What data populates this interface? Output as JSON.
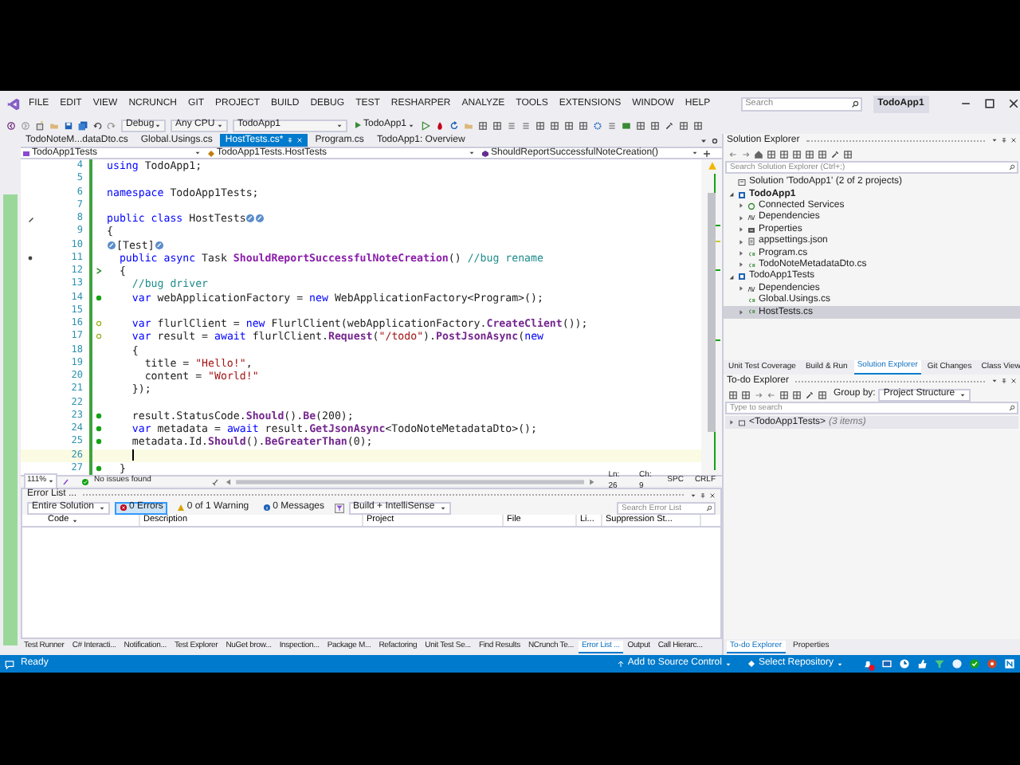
{
  "window": {
    "title": "TodoApp1"
  },
  "menu": [
    "FILE",
    "EDIT",
    "VIEW",
    "NCRUNCH",
    "GIT",
    "PROJECT",
    "BUILD",
    "DEBUG",
    "TEST",
    "RESHARPER",
    "ANALYZE",
    "TOOLS",
    "EXTENSIONS",
    "WINDOW",
    "HELP"
  ],
  "search": {
    "placeholder": "Search"
  },
  "toolbar": {
    "configuration": "Debug",
    "platform": "Any CPU",
    "startup_project": "TodoApp1",
    "start_button": "TodoApp1"
  },
  "document_tabs": [
    {
      "label": "TodoNoteM...dataDto.cs",
      "selected": false
    },
    {
      "label": "Global.Usings.cs",
      "selected": false
    },
    {
      "label": "HostTests.cs*",
      "selected": true
    },
    {
      "label": "Program.cs",
      "selected": false
    },
    {
      "label": "TodoApp1: Overview",
      "selected": false
    }
  ],
  "navigation_bar": [
    "TodoApp1Tests",
    "TodoApp1Tests.HostTests",
    "ShouldReportSuccessfulNoteCreation()"
  ],
  "editor": {
    "lines": [
      {
        "number": "4",
        "kind": "plain",
        "current": false,
        "segments": [
          {
            "kind": "keyword",
            "text": "using"
          },
          {
            "kind": "plain",
            "text": " TodoApp1;"
          }
        ]
      },
      {
        "number": "5",
        "kind": "plain",
        "current": false
      },
      {
        "number": "6",
        "kind": "plain",
        "current": false,
        "segments": [
          {
            "kind": "keyword",
            "text": "namespace"
          },
          {
            "kind": "plain",
            "text": " TodoApp1Tests;"
          }
        ]
      },
      {
        "number": "7",
        "kind": "plain",
        "current": false
      },
      {
        "number": "8",
        "kind": "plain",
        "current": false,
        "gutter": [
          {
            "kind": "edit"
          }
        ],
        "segments": [
          {
            "kind": "keyword",
            "text": "public class"
          },
          {
            "kind": "plain",
            "text": " HostTests"
          },
          {
            "kind": "hint"
          },
          {
            "kind": "hint"
          }
        ]
      },
      {
        "number": "9",
        "kind": "plain",
        "current": false,
        "segments": [
          {
            "kind": "plain",
            "text": "{"
          }
        ]
      },
      {
        "number": "10",
        "kind": "plain",
        "current": false,
        "segments": [
          {
            "kind": "hint"
          },
          {
            "kind": "plain",
            "text": "[Test]"
          },
          {
            "kind": "hint"
          }
        ]
      },
      {
        "number": "11",
        "kind": "plain",
        "current": false,
        "gutter": [
          {
            "kind": "bullet"
          }
        ],
        "segments": [
          {
            "kind": "keyword",
            "text": "  public async"
          },
          {
            "kind": "plain",
            "text": " Task "
          },
          {
            "kind": "declaration",
            "text": "ShouldReportSuccessfulNoteCreation"
          },
          {
            "kind": "plain",
            "text": "() "
          },
          {
            "kind": "comment",
            "text": "//bug rename"
          }
        ]
      },
      {
        "number": "12",
        "kind": "entry",
        "current": false,
        "segments": [
          {
            "kind": "plain",
            "text": "  {"
          }
        ]
      },
      {
        "number": "13",
        "kind": "plain",
        "current": false,
        "segments": [
          {
            "kind": "comment",
            "text": "    //bug driver"
          }
        ]
      },
      {
        "number": "14",
        "kind": "covered",
        "current": false,
        "segments": [
          {
            "kind": "keyword",
            "text": "    var"
          },
          {
            "kind": "plain",
            "text": " webApplicationFactory = "
          },
          {
            "kind": "keyword",
            "text": "new"
          },
          {
            "kind": "plain",
            "text": " WebApplicationFactory<Program>();"
          }
        ]
      },
      {
        "number": "15",
        "kind": "plain",
        "current": false
      },
      {
        "number": "16",
        "kind": "partial",
        "current": false,
        "segments": [
          {
            "kind": "keyword",
            "text": "    var"
          },
          {
            "kind": "plain",
            "text": " flurlClient = "
          },
          {
            "kind": "keyword",
            "text": "new"
          },
          {
            "kind": "plain",
            "text": " FlurlClient(webApplicationFactory."
          },
          {
            "kind": "method",
            "text": "CreateClient"
          },
          {
            "kind": "plain",
            "text": "());"
          }
        ]
      },
      {
        "number": "17",
        "kind": "partial",
        "current": false,
        "segments": [
          {
            "kind": "keyword",
            "text": "    var"
          },
          {
            "kind": "plain",
            "text": " result = "
          },
          {
            "kind": "keyword",
            "text": "await"
          },
          {
            "kind": "plain",
            "text": " flurlClient."
          },
          {
            "kind": "method",
            "text": "Request"
          },
          {
            "kind": "plain",
            "text": "("
          },
          {
            "kind": "string",
            "text": "\"/todo\""
          },
          {
            "kind": "plain",
            "text": ")."
          },
          {
            "kind": "method",
            "text": "PostJsonAsync"
          },
          {
            "kind": "plain",
            "text": "("
          },
          {
            "kind": "keyword",
            "text": "new"
          }
        ]
      },
      {
        "number": "18",
        "kind": "plain",
        "current": false,
        "segments": [
          {
            "kind": "plain",
            "text": "    {"
          }
        ]
      },
      {
        "number": "19",
        "kind": "plain",
        "current": false,
        "segments": [
          {
            "kind": "plain",
            "text": "      title = "
          },
          {
            "kind": "string",
            "text": "\"Hello!\""
          },
          {
            "kind": "plain",
            "text": ","
          }
        ]
      },
      {
        "number": "20",
        "kind": "plain",
        "current": false,
        "segments": [
          {
            "kind": "plain",
            "text": "      content = "
          },
          {
            "kind": "string",
            "text": "\"World!\""
          }
        ]
      },
      {
        "number": "21",
        "kind": "plain",
        "current": false,
        "segments": [
          {
            "kind": "plain",
            "text": "    });"
          }
        ]
      },
      {
        "number": "22",
        "kind": "plain",
        "current": false
      },
      {
        "number": "23",
        "kind": "covered",
        "current": false,
        "segments": [
          {
            "kind": "plain",
            "text": "    result.StatusCode."
          },
          {
            "kind": "method",
            "text": "Should"
          },
          {
            "kind": "plain",
            "text": "()."
          },
          {
            "kind": "method",
            "text": "Be"
          },
          {
            "kind": "plain",
            "text": "(200);"
          }
        ]
      },
      {
        "number": "24",
        "kind": "covered",
        "current": false,
        "segments": [
          {
            "kind": "keyword",
            "text": "    var"
          },
          {
            "kind": "plain",
            "text": " metadata = "
          },
          {
            "kind": "keyword",
            "text": "await"
          },
          {
            "kind": "plain",
            "text": " result."
          },
          {
            "kind": "method",
            "text": "GetJsonAsync"
          },
          {
            "kind": "plain",
            "text": "<TodoNoteMetadataDto>();"
          }
        ]
      },
      {
        "number": "25",
        "kind": "covered",
        "current": false,
        "segments": [
          {
            "kind": "plain",
            "text": "    metadata.Id."
          },
          {
            "kind": "method",
            "text": "Should"
          },
          {
            "kind": "plain",
            "text": "()."
          },
          {
            "kind": "method",
            "text": "BeGreaterThan"
          },
          {
            "kind": "plain",
            "text": "(0);"
          }
        ]
      },
      {
        "number": "26",
        "kind": "plain",
        "current": true
      },
      {
        "number": "27",
        "kind": "covered",
        "current": false,
        "segments": [
          {
            "kind": "plain",
            "text": "  }"
          }
        ]
      }
    ]
  },
  "editor_status": {
    "zoom": "111%",
    "issues": "No issues found",
    "line": "Ln: 26",
    "column": "Ch: 9",
    "whitespace": "SPC",
    "line_ending": "CRLF"
  },
  "error_list": {
    "title": "Error List ...",
    "scope": "Entire Solution",
    "filters": [
      {
        "kind": "error",
        "label": "0 Errors",
        "on": true
      },
      {
        "kind": "warning",
        "label": "0 of 1 Warning",
        "on": false
      },
      {
        "kind": "message",
        "label": "0 Messages",
        "on": false
      }
    ],
    "source": "Build + IntelliSense",
    "search": {
      "placeholder": "Search Error List"
    },
    "columns": [
      "Code",
      "Description",
      "Project",
      "File",
      "Li...",
      "Suppression St..."
    ]
  },
  "bottom_tabs": [
    {
      "label": "Test Runner",
      "selected": false
    },
    {
      "label": "C# Interacti...",
      "selected": false
    },
    {
      "label": "Notification...",
      "selected": false
    },
    {
      "label": "Test Explorer",
      "selected": false
    },
    {
      "label": "NuGet brow...",
      "selected": false
    },
    {
      "label": "Inspection...",
      "selected": false
    },
    {
      "label": "Package M...",
      "selected": false
    },
    {
      "label": "Refactoring",
      "selected": false
    },
    {
      "label": "Unit Test Se...",
      "selected": false
    },
    {
      "label": "Find Results",
      "selected": false
    },
    {
      "label": "NCrunch Te...",
      "selected": false
    },
    {
      "label": "Error List ...",
      "selected": true
    },
    {
      "label": "Output",
      "selected": false
    },
    {
      "label": "Call Hierarc...",
      "selected": false
    }
  ],
  "solution_explorer": {
    "title": "Solution Explorer",
    "search": {
      "placeholder": "Search Solution Explorer (Ctrl+;)"
    },
    "tree": [
      {
        "label": "Solution 'TodoApp1' (2 of 2 projects)",
        "kind": "solution",
        "selected": false,
        "startup": false
      },
      {
        "label": "TodoApp1",
        "kind": "project",
        "selected": false,
        "startup": true,
        "expanded": true,
        "children": [
          {
            "label": "Connected Services",
            "kind": "service",
            "selected": false,
            "startup": false,
            "expanded": false
          },
          {
            "label": "Dependencies",
            "kind": "dependencies",
            "selected": false,
            "startup": false,
            "expanded": false
          },
          {
            "label": "Properties",
            "kind": "properties",
            "selected": false,
            "startup": false,
            "expanded": false
          },
          {
            "label": "appsettings.json",
            "kind": "json",
            "selected": false,
            "startup": false,
            "expanded": false
          },
          {
            "label": "Program.cs",
            "kind": "csharp",
            "selected": false,
            "startup": false,
            "expanded": false
          },
          {
            "label": "TodoNoteMetadataDto.cs",
            "kind": "csharp",
            "selected": false,
            "startup": false,
            "expanded": false
          }
        ]
      },
      {
        "label": "TodoApp1Tests",
        "kind": "project",
        "selected": false,
        "startup": false,
        "expanded": true,
        "children": [
          {
            "label": "Dependencies",
            "kind": "dependencies",
            "selected": false,
            "startup": false,
            "expanded": false
          },
          {
            "label": "Global.Usings.cs",
            "kind": "csharp",
            "selected": false,
            "startup": false
          },
          {
            "label": "HostTests.cs",
            "kind": "csharp",
            "selected": true,
            "startup": false,
            "expanded": false
          }
        ]
      }
    ]
  },
  "panel_tabs": [
    {
      "label": "Unit Test Coverage",
      "selected": false
    },
    {
      "label": "Build & Run",
      "selected": false
    },
    {
      "label": "Solution Explorer",
      "selected": true
    },
    {
      "label": "Git Changes",
      "selected": false
    },
    {
      "label": "Class View",
      "selected": false
    }
  ],
  "todo_explorer": {
    "title": "To-do Explorer",
    "group_by_label": "Group by:",
    "group_by": "Project Structure",
    "search": {
      "placeholder": "Type to search"
    },
    "items": [
      {
        "label": "<TodoApp1Tests>",
        "count": "(3 items)",
        "expanded": false
      }
    ]
  },
  "right_bottom_tabs": [
    {
      "label": "To-do Explorer",
      "selected": true
    },
    {
      "label": "Properties",
      "selected": false
    }
  ],
  "status_bar": {
    "text": "Ready",
    "source_control": "Add to Source Control",
    "repository": "Select Repository"
  }
}
